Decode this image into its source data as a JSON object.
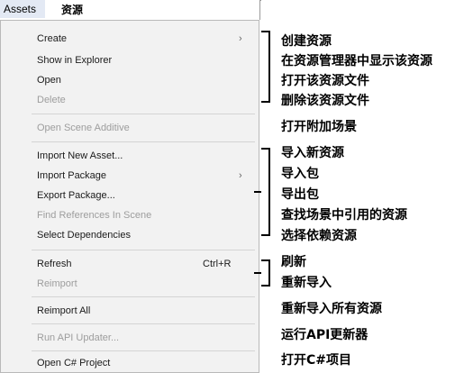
{
  "menubar": {
    "active": "Assets",
    "title_cn": "资源"
  },
  "menu": {
    "create": "Create",
    "show_in_explorer": "Show in Explorer",
    "open": "Open",
    "delete": "Delete",
    "open_scene_additive": "Open Scene Additive",
    "import_new_asset": "Import New Asset...",
    "import_package": "Import Package",
    "export_package": "Export Package...",
    "find_references": "Find References In Scene",
    "select_dependencies": "Select Dependencies",
    "refresh": "Refresh",
    "refresh_shortcut": "Ctrl+R",
    "reimport": "Reimport",
    "reimport_all": "Reimport All",
    "run_api_updater": "Run API Updater...",
    "open_csharp_project": "Open C# Project",
    "submenu_arrow": "›"
  },
  "annotations": {
    "create": "创建资源",
    "show_in_explorer": "在资源管理器中显示该资源",
    "open": "打开该资源文件",
    "delete": "删除该资源文件",
    "open_scene_additive": "打开附加场景",
    "import_new_asset": "导入新资源",
    "import_package": "导入包",
    "export_package": "导出包",
    "find_references": "查找场景中引用的资源",
    "select_dependencies": "选择依赖资源",
    "refresh": "刷新",
    "reimport": "重新导入",
    "reimport_all": "重新导入所有资源",
    "run_api_updater": "运行API更新器",
    "open_csharp_project": "打开C#项目"
  }
}
